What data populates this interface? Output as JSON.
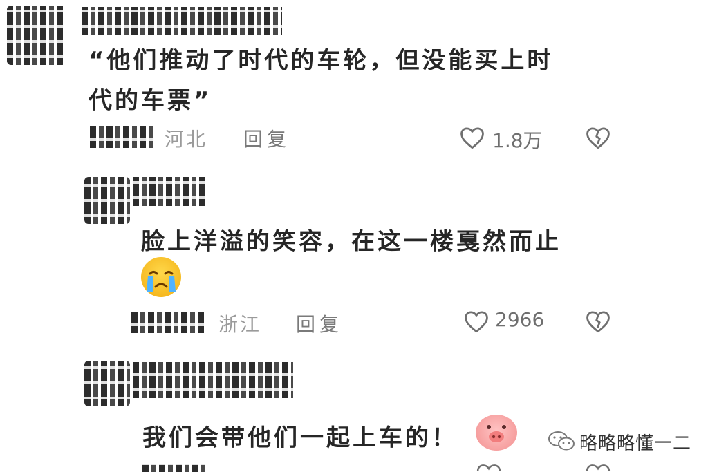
{
  "comments": [
    {
      "text_line1": "“他们推动了时代的车轮，但没能买上时",
      "text_line2": "代的车票”",
      "location": "河北",
      "reply_label": "回复",
      "likes": "1.8万"
    },
    {
      "text_line1": "脸上洋溢的笑容，在这一楼戛然而止",
      "location": "浙江",
      "reply_label": "回复",
      "likes": "2966"
    },
    {
      "text_line1": "我们会带他们一起上车的！"
    }
  ],
  "watermark": {
    "text": "略略略懂一二",
    "icon": "wechat-icon"
  },
  "icons": {
    "like": "heart-outline-icon",
    "dislike": "broken-heart-icon",
    "emoji_1": "crying-face-emoji",
    "emoji_2": "pig-face-emoji"
  }
}
